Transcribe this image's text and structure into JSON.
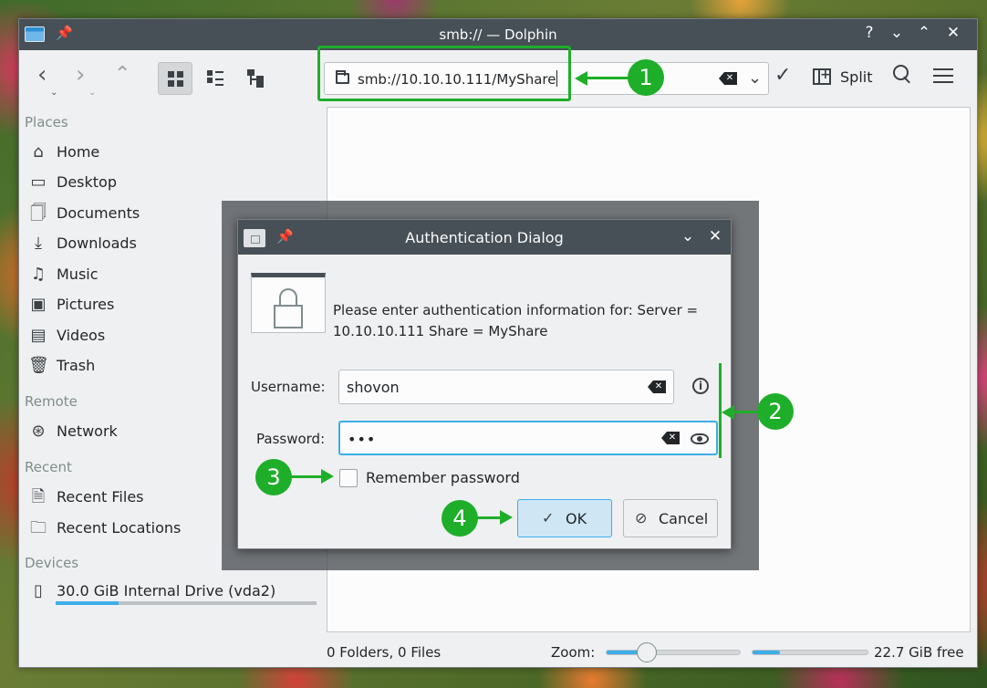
{
  "window": {
    "title": "smb:// — Dolphin"
  },
  "toolbar": {
    "url": "smb://10.10.10.111/MyShare",
    "split_label": "Split"
  },
  "sidebar": {
    "places_header": "Places",
    "places": [
      {
        "label": "Home",
        "icon": "home-icon"
      },
      {
        "label": "Desktop",
        "icon": "desktop-icon"
      },
      {
        "label": "Documents",
        "icon": "documents-icon"
      },
      {
        "label": "Downloads",
        "icon": "downloads-icon"
      },
      {
        "label": "Music",
        "icon": "music-icon"
      },
      {
        "label": "Pictures",
        "icon": "pictures-icon"
      },
      {
        "label": "Videos",
        "icon": "videos-icon"
      },
      {
        "label": "Trash",
        "icon": "trash-icon"
      }
    ],
    "remote_header": "Remote",
    "remote": [
      {
        "label": "Network",
        "icon": "network-icon"
      }
    ],
    "recent_header": "Recent",
    "recent": [
      {
        "label": "Recent Files",
        "icon": "recent-files-icon"
      },
      {
        "label": "Recent Locations",
        "icon": "recent-locations-icon"
      }
    ],
    "devices_header": "Devices",
    "devices": [
      {
        "label": "30.0 GiB Internal Drive (vda2)",
        "icon": "drive-icon",
        "usage_fraction": 0.24
      }
    ]
  },
  "statusbar": {
    "summary": "0 Folders, 0 Files",
    "zoom_label": "Zoom:",
    "zoom_fraction": 0.3,
    "free_space": "22.7 GiB free",
    "space_used_fraction": 0.24
  },
  "dialog": {
    "title": "Authentication Dialog",
    "message": "Please enter authentication information for: Server = 10.10.10.111 Share = MyShare",
    "username_label": "Username:",
    "username_value": "shovon",
    "password_label": "Password:",
    "password_mask": "•••",
    "remember_label": "Remember password",
    "remember_checked": false,
    "ok_label": "OK",
    "cancel_label": "Cancel"
  },
  "annotations": [
    "1",
    "2",
    "3",
    "4"
  ],
  "colors": {
    "accent": "#3daee9",
    "annotation": "#1eae2a",
    "titlebar": "#475057"
  }
}
